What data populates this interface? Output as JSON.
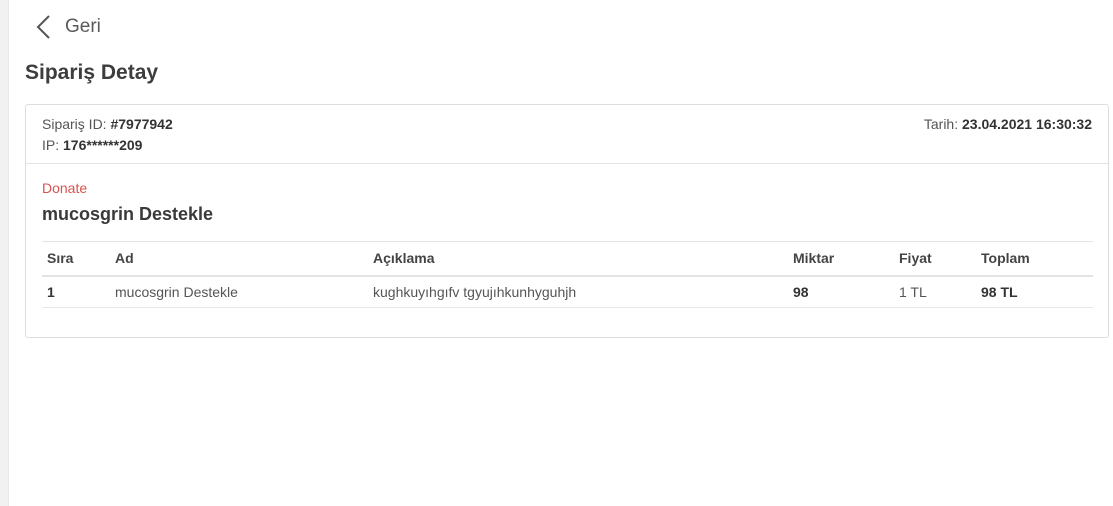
{
  "nav": {
    "back_label": "Geri"
  },
  "page": {
    "title": "Sipariş Detay"
  },
  "order": {
    "id_label": "Sipariş ID:",
    "id_value": "#7977942",
    "ip_label": "IP:",
    "ip_value": "176******209",
    "date_label": "Tarih:",
    "date_value": "23.04.2021 16:30:32"
  },
  "product": {
    "tag": "Donate",
    "name": "mucosgrin Destekle"
  },
  "table": {
    "headers": [
      "Sıra",
      "Ad",
      "Açıklama",
      "Miktar",
      "Fiyat",
      "Toplam"
    ],
    "rows": [
      [
        "1",
        "mucosgrin Destekle",
        "kughkuyıhgıfv tgyujıhkunhyguhjh",
        "98",
        "1 TL",
        "98 TL"
      ]
    ]
  },
  "colors": {
    "accent_red": "#d9534f",
    "border": "#dedede",
    "rail": "#f1f1f1"
  }
}
